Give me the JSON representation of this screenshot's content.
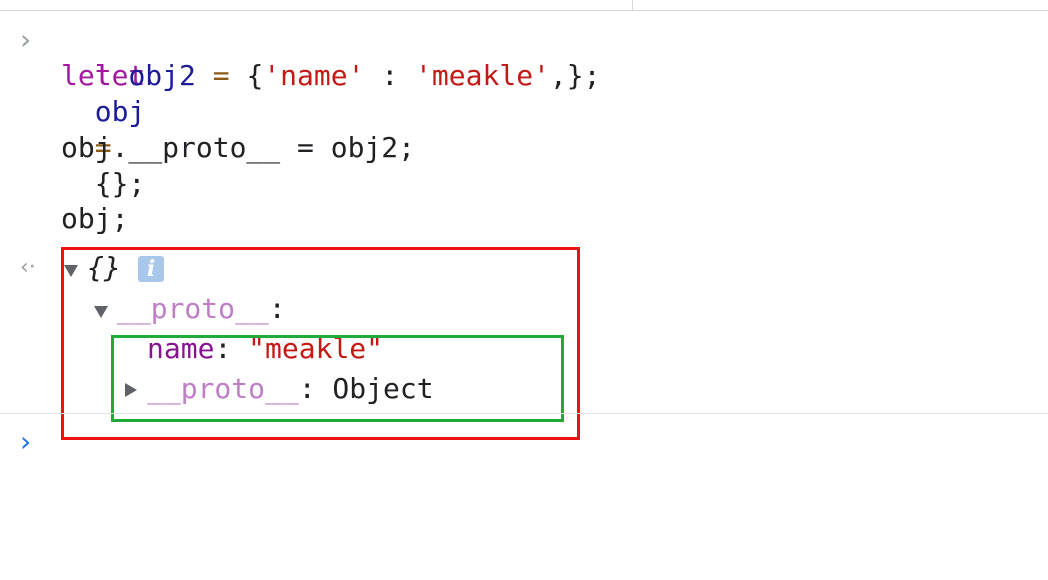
{
  "console": {
    "input_prompt_glyph": "›",
    "result_glyph": "‹·",
    "input": {
      "line1": {
        "kw": "let",
        "ident": "obj",
        "op": "=",
        "rest": "{};"
      },
      "line2": {
        "kw": "let",
        "ident": "obj2",
        "op": "=",
        "open": "{",
        "str1": "'name'",
        "colon": " : ",
        "str2": "'meakle'",
        "close": ",};"
      },
      "line3": {
        "text": "obj.__proto__ = obj2;"
      },
      "line4": {
        "text": "obj;"
      }
    },
    "output": {
      "root_label": "{}",
      "info_icon_label": "i",
      "proto_key": "__proto__",
      "proto_colon": ":",
      "name_key": "name",
      "name_colon": ": ",
      "name_value": "\"meakle\"",
      "nested_proto_key": "__proto__",
      "nested_proto_value": ": Object"
    },
    "active_prompt_glyph": "›"
  },
  "colors": {
    "highlight_outer": "#ee1111",
    "highlight_inner": "#1faa3a",
    "prompt_active": "#1a73e8"
  }
}
